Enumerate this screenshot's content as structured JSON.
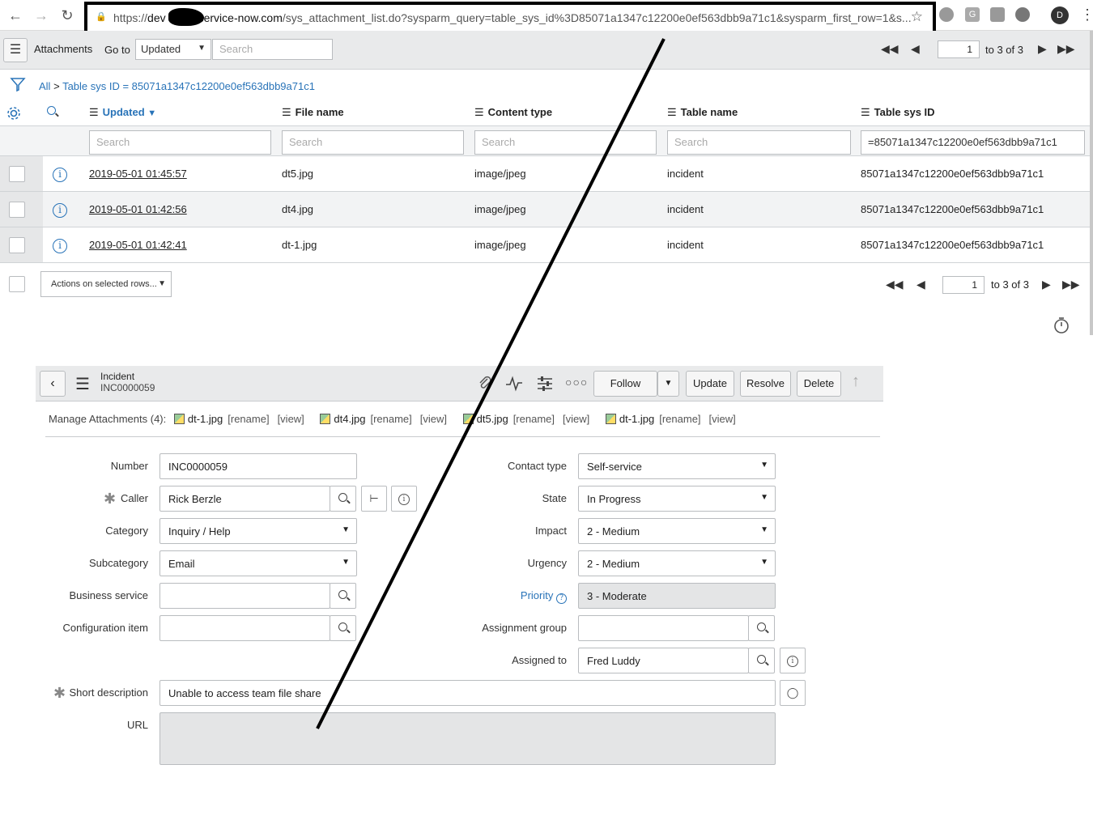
{
  "browser": {
    "url_scheme": "https://",
    "url_prefix": "dev",
    "url_host_rest": "service-now.com",
    "url_path": "/sys_attachment_list.do?sysparm_query=table_sys_id%3D85071a1347c12200e0ef563dbb9a71c1&sysparm_first_row=1&s...",
    "profile_initial": "D"
  },
  "list": {
    "title": "Attachments",
    "goto_label": "Go to",
    "goto_field": "Updated",
    "search_placeholder": "Search",
    "pager": {
      "page": "1",
      "range": "to 3 of 3"
    },
    "breadcrumb": {
      "all": "All",
      "separator": ">",
      "condition": "Table sys ID = 85071a1347c12200e0ef563dbb9a71c1"
    },
    "columns": [
      "Updated",
      "File name",
      "Content type",
      "Table name",
      "Table sys ID"
    ],
    "filters": [
      "Search",
      "Search",
      "Search",
      "Search",
      "=85071a1347c12200e0ef563dbb9a71c1"
    ],
    "rows": [
      {
        "updated": "2019-05-01 01:45:57",
        "file_name": "dt5.jpg",
        "content_type": "image/jpeg",
        "table_name": "incident",
        "table_sys_id": "85071a1347c12200e0ef563dbb9a71c1"
      },
      {
        "updated": "2019-05-01 01:42:56",
        "file_name": "dt4.jpg",
        "content_type": "image/jpeg",
        "table_name": "incident",
        "table_sys_id": "85071a1347c12200e0ef563dbb9a71c1"
      },
      {
        "updated": "2019-05-01 01:42:41",
        "file_name": "dt-1.jpg",
        "content_type": "image/jpeg",
        "table_name": "incident",
        "table_sys_id": "85071a1347c12200e0ef563dbb9a71c1"
      }
    ],
    "actions_label": "Actions on selected rows..."
  },
  "form": {
    "table": "Incident",
    "number_header": "INC0000059",
    "buttons": {
      "follow": "Follow",
      "update": "Update",
      "resolve": "Resolve",
      "delete": "Delete"
    },
    "attachments": {
      "label": "Manage Attachments (4):",
      "files": [
        "dt-1.jpg",
        "dt4.jpg",
        "dt5.jpg",
        "dt-1.jpg"
      ],
      "rename": "[rename]",
      "view": "[view]"
    },
    "fields": {
      "number": {
        "label": "Number",
        "value": "INC0000059"
      },
      "caller": {
        "label": "Caller",
        "value": "Rick Berzle"
      },
      "category": {
        "label": "Category",
        "value": "Inquiry / Help"
      },
      "subcategory": {
        "label": "Subcategory",
        "value": "Email"
      },
      "business_service": {
        "label": "Business service",
        "value": ""
      },
      "configuration_item": {
        "label": "Configuration item",
        "value": ""
      },
      "contact_type": {
        "label": "Contact type",
        "value": "Self-service"
      },
      "state": {
        "label": "State",
        "value": "In Progress"
      },
      "impact": {
        "label": "Impact",
        "value": "2 - Medium"
      },
      "urgency": {
        "label": "Urgency",
        "value": "2 - Medium"
      },
      "priority": {
        "label": "Priority",
        "value": "3 - Moderate"
      },
      "assignment_group": {
        "label": "Assignment group",
        "value": ""
      },
      "assigned_to": {
        "label": "Assigned to",
        "value": "Fred Luddy"
      },
      "short_description": {
        "label": "Short description",
        "value": "Unable to access team file share"
      },
      "url": {
        "label": "URL",
        "value": ""
      }
    }
  },
  "colors": {
    "link": "#2873b8",
    "header_bg": "#e9eaeb",
    "annotation": "#000000"
  }
}
